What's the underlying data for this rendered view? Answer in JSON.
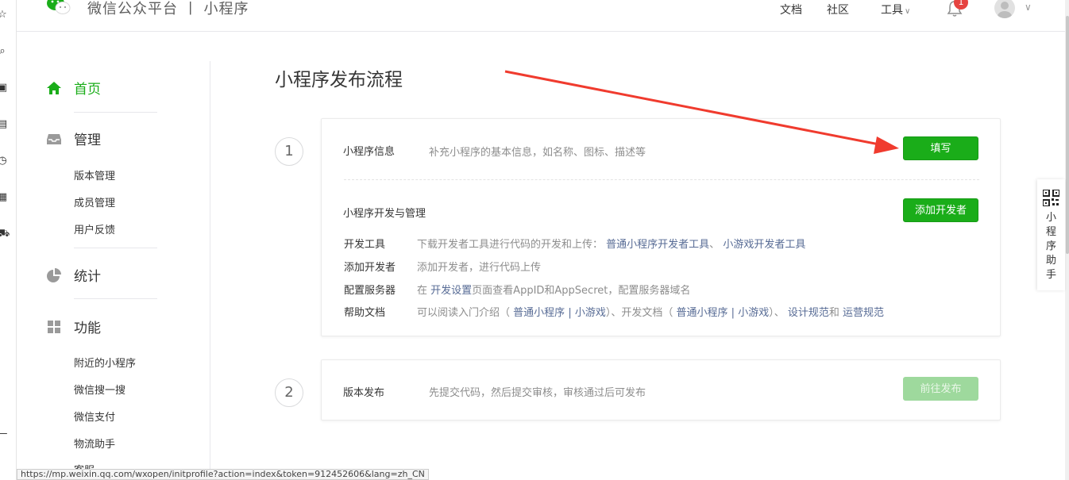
{
  "header": {
    "brand": "微信公众平台 丨 小程序",
    "links": {
      "docs": "文档",
      "community": "社区",
      "tools": "工具"
    },
    "notification_count": "1"
  },
  "sidebar": {
    "home": "首页",
    "manage": "管理",
    "manage_items": [
      "版本管理",
      "成员管理",
      "用户反馈"
    ],
    "stats": "统计",
    "features": "功能",
    "feature_items": [
      "附近的小程序",
      "微信搜一搜",
      "微信支付",
      "物流助手",
      "客服"
    ]
  },
  "main": {
    "title": "小程序发布流程",
    "step1": {
      "number": "1",
      "info_title": "小程序信息",
      "info_desc": "补充小程序的基本信息，如名称、图标、描述等",
      "fill_button": "填写",
      "dev_title": "小程序开发与管理",
      "add_dev_button": "添加开发者",
      "rows": {
        "tools_label": "开发工具",
        "tools_text": "下载开发者工具进行代码的开发和上传：",
        "tools_link1": "普通小程序开发者工具",
        "tools_sep": "、",
        "tools_link2": "小游戏开发者工具",
        "add_label": "添加开发者",
        "add_text": "添加开发者，进行代码上传",
        "server_label": "配置服务器",
        "server_pre": "在",
        "server_link": "开发设置",
        "server_post": "页面查看AppID和AppSecret，配置服务器域名",
        "help_label": "帮助文档",
        "help_pre": "可以阅读入门介绍（",
        "help_link1": "普通小程序",
        "help_bar1": "|",
        "help_link2": "小游戏",
        "help_mid": "）、开发文档（",
        "help_link3": "普通小程序",
        "help_bar2": "|",
        "help_link4": "小游戏",
        "help_mid2": "）、",
        "help_link5": "设计规范",
        "help_and": "和",
        "help_link6": "运营规范"
      }
    },
    "step2": {
      "number": "2",
      "title": "版本发布",
      "desc": "先提交代码，然后提交审核，审核通过后可发布",
      "publish_button": "前往发布"
    }
  },
  "helper": {
    "label": "小程序助手"
  },
  "status_url": "https://mp.weixin.qq.com/wxopen/initprofile?action=index&token=912452606&lang=zh_CN",
  "colors": {
    "brand_green": "#1aad19",
    "link": "#576b95",
    "arrow": "#f03b2e"
  },
  "icons": [
    "wechat-logo-icon",
    "chevron-down-icon",
    "bell-icon",
    "avatar-icon",
    "home-icon",
    "inbox-icon",
    "pie-chart-icon",
    "grid-icon",
    "qr-code-icon"
  ]
}
